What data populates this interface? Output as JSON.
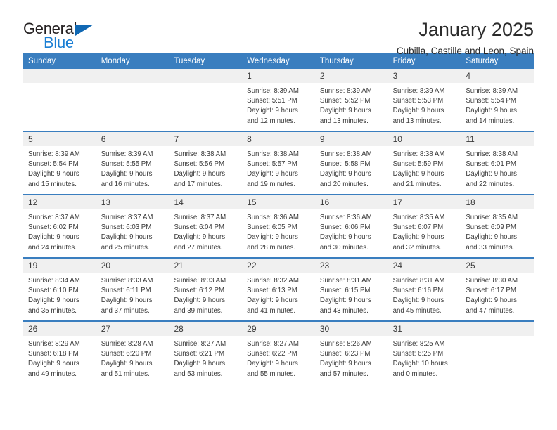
{
  "logo": {
    "word_one": "General",
    "word_two": "Blue",
    "triangle_icon": "blue-triangle-icon",
    "colors": {
      "dark": "#231f20",
      "blue": "#1b7fd4",
      "triangle": "#1068b3"
    }
  },
  "header": {
    "title": "January 2025",
    "subtitle": "Cubilla, Castille and Leon, Spain"
  },
  "theme": {
    "header_bg": "#3a7ebf",
    "header_text": "#ffffff",
    "daynum_band": "#f0f0f0",
    "body_text": "#3a3a3a"
  },
  "calendar": {
    "weekday_headers": [
      "Sunday",
      "Monday",
      "Tuesday",
      "Wednesday",
      "Thursday",
      "Friday",
      "Saturday"
    ],
    "weeks": [
      [
        {
          "day": "",
          "empty": true,
          "lines": []
        },
        {
          "day": "",
          "empty": true,
          "lines": []
        },
        {
          "day": "",
          "empty": true,
          "lines": []
        },
        {
          "day": "1",
          "empty": false,
          "lines": [
            "Sunrise: 8:39 AM",
            "Sunset: 5:51 PM",
            "Daylight: 9 hours",
            "and 12 minutes."
          ]
        },
        {
          "day": "2",
          "empty": false,
          "lines": [
            "Sunrise: 8:39 AM",
            "Sunset: 5:52 PM",
            "Daylight: 9 hours",
            "and 13 minutes."
          ]
        },
        {
          "day": "3",
          "empty": false,
          "lines": [
            "Sunrise: 8:39 AM",
            "Sunset: 5:53 PM",
            "Daylight: 9 hours",
            "and 13 minutes."
          ]
        },
        {
          "day": "4",
          "empty": false,
          "lines": [
            "Sunrise: 8:39 AM",
            "Sunset: 5:54 PM",
            "Daylight: 9 hours",
            "and 14 minutes."
          ]
        }
      ],
      [
        {
          "day": "5",
          "empty": false,
          "lines": [
            "Sunrise: 8:39 AM",
            "Sunset: 5:54 PM",
            "Daylight: 9 hours",
            "and 15 minutes."
          ]
        },
        {
          "day": "6",
          "empty": false,
          "lines": [
            "Sunrise: 8:39 AM",
            "Sunset: 5:55 PM",
            "Daylight: 9 hours",
            "and 16 minutes."
          ]
        },
        {
          "day": "7",
          "empty": false,
          "lines": [
            "Sunrise: 8:38 AM",
            "Sunset: 5:56 PM",
            "Daylight: 9 hours",
            "and 17 minutes."
          ]
        },
        {
          "day": "8",
          "empty": false,
          "lines": [
            "Sunrise: 8:38 AM",
            "Sunset: 5:57 PM",
            "Daylight: 9 hours",
            "and 19 minutes."
          ]
        },
        {
          "day": "9",
          "empty": false,
          "lines": [
            "Sunrise: 8:38 AM",
            "Sunset: 5:58 PM",
            "Daylight: 9 hours",
            "and 20 minutes."
          ]
        },
        {
          "day": "10",
          "empty": false,
          "lines": [
            "Sunrise: 8:38 AM",
            "Sunset: 5:59 PM",
            "Daylight: 9 hours",
            "and 21 minutes."
          ]
        },
        {
          "day": "11",
          "empty": false,
          "lines": [
            "Sunrise: 8:38 AM",
            "Sunset: 6:01 PM",
            "Daylight: 9 hours",
            "and 22 minutes."
          ]
        }
      ],
      [
        {
          "day": "12",
          "empty": false,
          "lines": [
            "Sunrise: 8:37 AM",
            "Sunset: 6:02 PM",
            "Daylight: 9 hours",
            "and 24 minutes."
          ]
        },
        {
          "day": "13",
          "empty": false,
          "lines": [
            "Sunrise: 8:37 AM",
            "Sunset: 6:03 PM",
            "Daylight: 9 hours",
            "and 25 minutes."
          ]
        },
        {
          "day": "14",
          "empty": false,
          "lines": [
            "Sunrise: 8:37 AM",
            "Sunset: 6:04 PM",
            "Daylight: 9 hours",
            "and 27 minutes."
          ]
        },
        {
          "day": "15",
          "empty": false,
          "lines": [
            "Sunrise: 8:36 AM",
            "Sunset: 6:05 PM",
            "Daylight: 9 hours",
            "and 28 minutes."
          ]
        },
        {
          "day": "16",
          "empty": false,
          "lines": [
            "Sunrise: 8:36 AM",
            "Sunset: 6:06 PM",
            "Daylight: 9 hours",
            "and 30 minutes."
          ]
        },
        {
          "day": "17",
          "empty": false,
          "lines": [
            "Sunrise: 8:35 AM",
            "Sunset: 6:07 PM",
            "Daylight: 9 hours",
            "and 32 minutes."
          ]
        },
        {
          "day": "18",
          "empty": false,
          "lines": [
            "Sunrise: 8:35 AM",
            "Sunset: 6:09 PM",
            "Daylight: 9 hours",
            "and 33 minutes."
          ]
        }
      ],
      [
        {
          "day": "19",
          "empty": false,
          "lines": [
            "Sunrise: 8:34 AM",
            "Sunset: 6:10 PM",
            "Daylight: 9 hours",
            "and 35 minutes."
          ]
        },
        {
          "day": "20",
          "empty": false,
          "lines": [
            "Sunrise: 8:33 AM",
            "Sunset: 6:11 PM",
            "Daylight: 9 hours",
            "and 37 minutes."
          ]
        },
        {
          "day": "21",
          "empty": false,
          "lines": [
            "Sunrise: 8:33 AM",
            "Sunset: 6:12 PM",
            "Daylight: 9 hours",
            "and 39 minutes."
          ]
        },
        {
          "day": "22",
          "empty": false,
          "lines": [
            "Sunrise: 8:32 AM",
            "Sunset: 6:13 PM",
            "Daylight: 9 hours",
            "and 41 minutes."
          ]
        },
        {
          "day": "23",
          "empty": false,
          "lines": [
            "Sunrise: 8:31 AM",
            "Sunset: 6:15 PM",
            "Daylight: 9 hours",
            "and 43 minutes."
          ]
        },
        {
          "day": "24",
          "empty": false,
          "lines": [
            "Sunrise: 8:31 AM",
            "Sunset: 6:16 PM",
            "Daylight: 9 hours",
            "and 45 minutes."
          ]
        },
        {
          "day": "25",
          "empty": false,
          "lines": [
            "Sunrise: 8:30 AM",
            "Sunset: 6:17 PM",
            "Daylight: 9 hours",
            "and 47 minutes."
          ]
        }
      ],
      [
        {
          "day": "26",
          "empty": false,
          "lines": [
            "Sunrise: 8:29 AM",
            "Sunset: 6:18 PM",
            "Daylight: 9 hours",
            "and 49 minutes."
          ]
        },
        {
          "day": "27",
          "empty": false,
          "lines": [
            "Sunrise: 8:28 AM",
            "Sunset: 6:20 PM",
            "Daylight: 9 hours",
            "and 51 minutes."
          ]
        },
        {
          "day": "28",
          "empty": false,
          "lines": [
            "Sunrise: 8:27 AM",
            "Sunset: 6:21 PM",
            "Daylight: 9 hours",
            "and 53 minutes."
          ]
        },
        {
          "day": "29",
          "empty": false,
          "lines": [
            "Sunrise: 8:27 AM",
            "Sunset: 6:22 PM",
            "Daylight: 9 hours",
            "and 55 minutes."
          ]
        },
        {
          "day": "30",
          "empty": false,
          "lines": [
            "Sunrise: 8:26 AM",
            "Sunset: 6:23 PM",
            "Daylight: 9 hours",
            "and 57 minutes."
          ]
        },
        {
          "day": "31",
          "empty": false,
          "lines": [
            "Sunrise: 8:25 AM",
            "Sunset: 6:25 PM",
            "Daylight: 10 hours",
            "and 0 minutes."
          ]
        },
        {
          "day": "",
          "empty": true,
          "lines": []
        }
      ]
    ]
  }
}
